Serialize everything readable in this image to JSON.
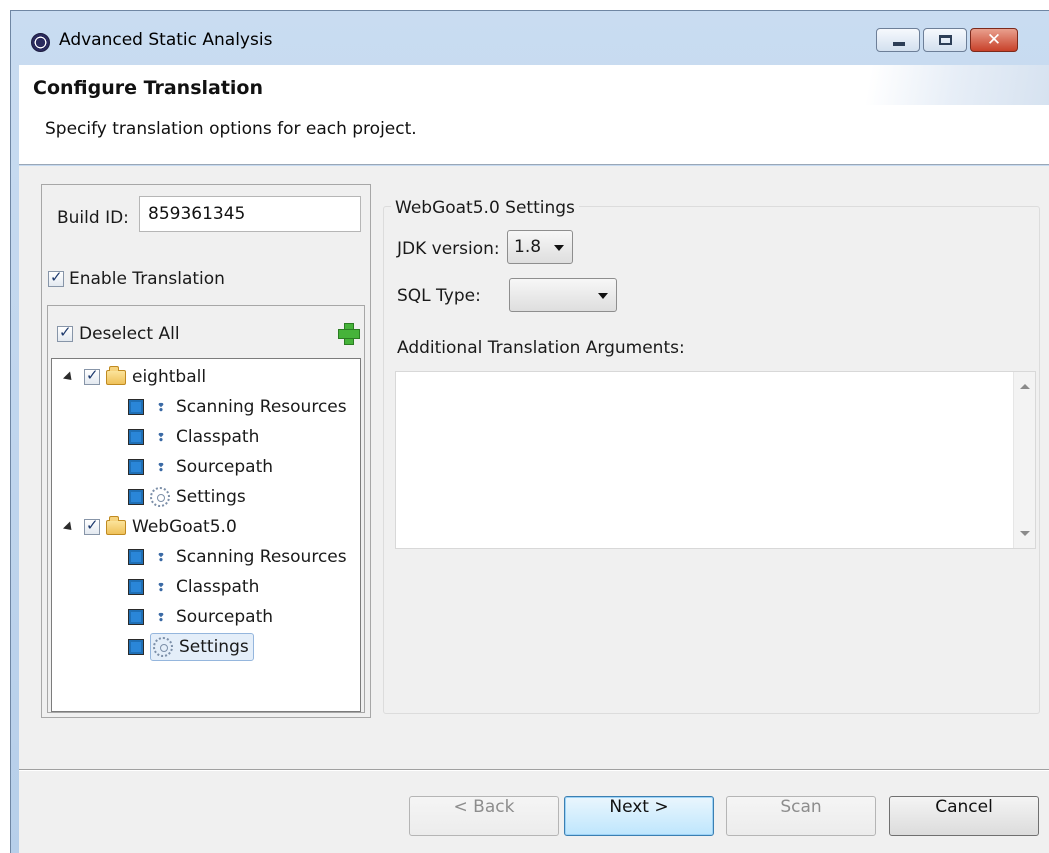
{
  "window": {
    "title": "Advanced Static Analysis"
  },
  "header": {
    "title": "Configure Translation",
    "description": "Specify translation options for each project."
  },
  "left": {
    "build_id_label": "Build ID:",
    "build_id_value": "859361345",
    "enable_translation_label": "Enable Translation",
    "enable_translation_checked": true,
    "deselect_all_label": "Deselect All",
    "deselect_all_checked": true,
    "tree": [
      {
        "label": "eightball",
        "checked": true,
        "children": [
          "Scanning Resources",
          "Classpath",
          "Sourcepath",
          "Settings"
        ]
      },
      {
        "label": "WebGoat5.0",
        "checked": true,
        "children": [
          "Scanning Resources",
          "Classpath",
          "Sourcepath",
          "Settings"
        ]
      }
    ]
  },
  "settings": {
    "group_title": "WebGoat5.0 Settings",
    "jdk_label": "JDK version:",
    "jdk_value": "1.8",
    "sql_label": "SQL Type:",
    "sql_value": "",
    "args_label": "Additional Translation Arguments:",
    "args_value": ""
  },
  "buttons": {
    "back": "< Back",
    "next": "Next >",
    "scan": "Scan",
    "cancel": "Cancel"
  }
}
